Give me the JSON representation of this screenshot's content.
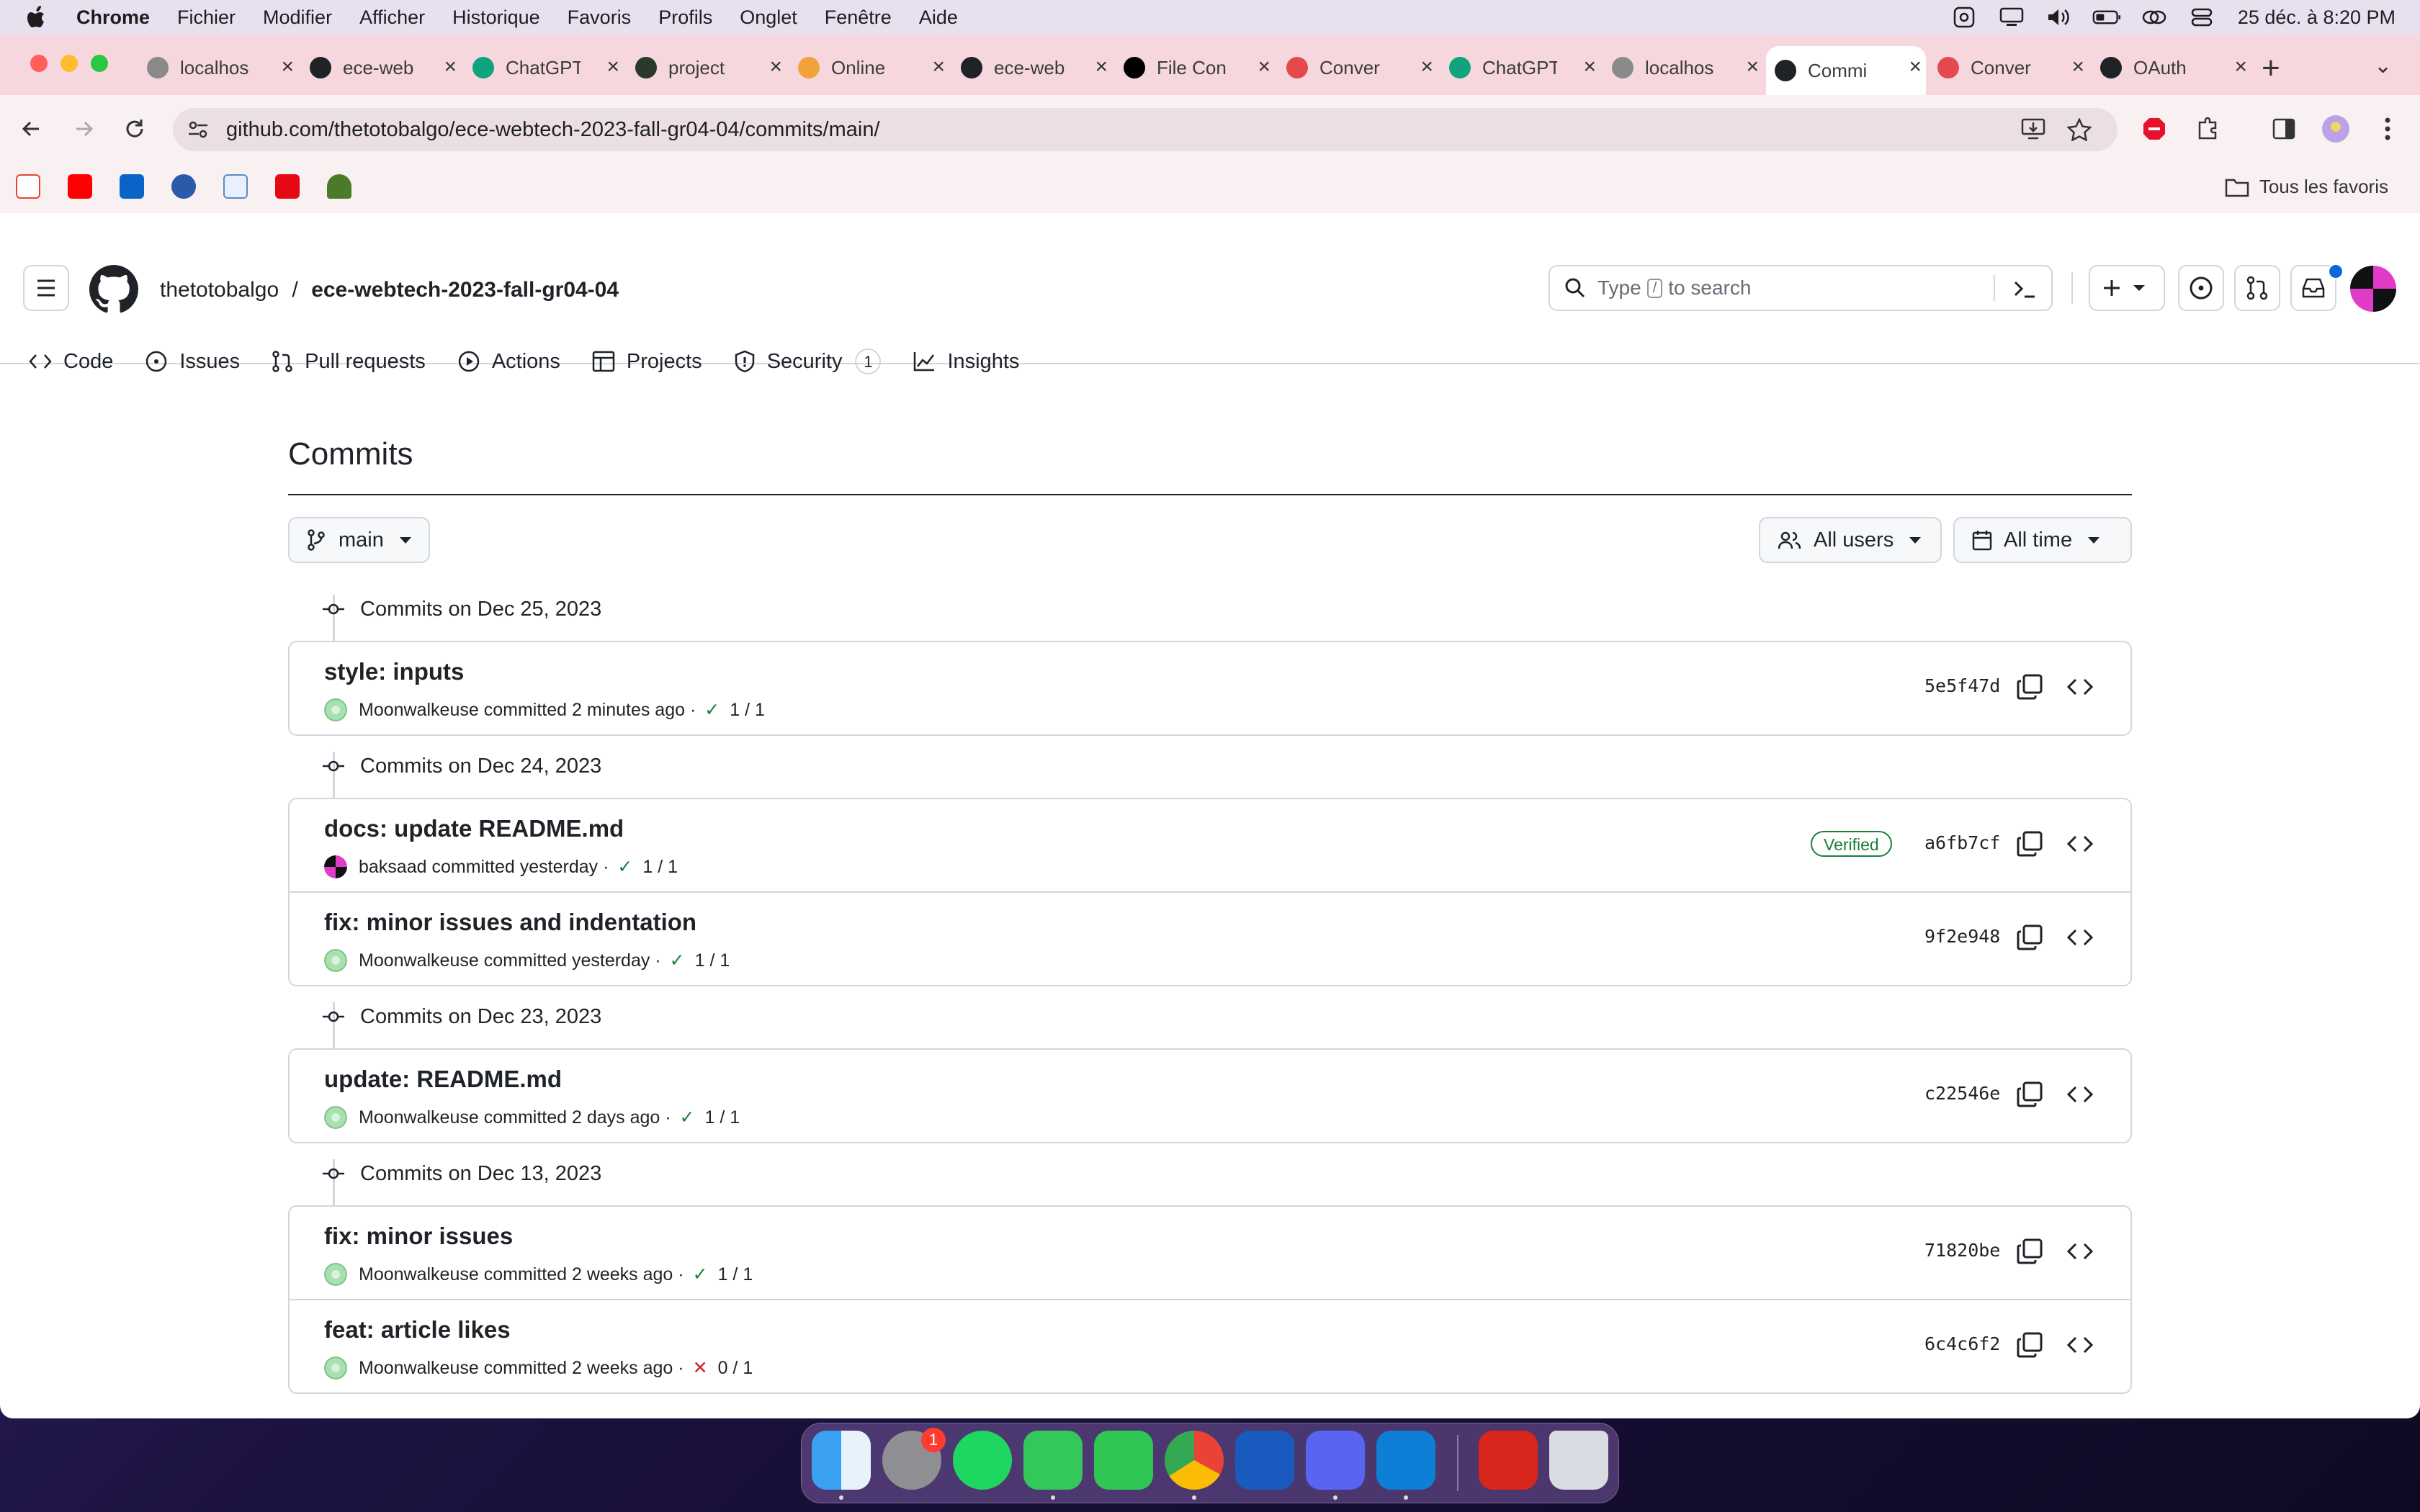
{
  "menubar": {
    "app": "Chrome",
    "items": [
      "Fichier",
      "Modifier",
      "Afficher",
      "Historique",
      "Favoris",
      "Profils",
      "Onglet",
      "Fenêtre",
      "Aide"
    ],
    "clock": "25 déc. à 8:20 PM"
  },
  "tabs": [
    {
      "title": "localhos",
      "icon": "globe-icon"
    },
    {
      "title": "ece-web",
      "icon": "github-icon"
    },
    {
      "title": "ChatGPT",
      "icon": "openai-icon"
    },
    {
      "title": "project",
      "icon": "project-icon"
    },
    {
      "title": "Online",
      "icon": "online-icon"
    },
    {
      "title": "ece-web",
      "icon": "github-icon"
    },
    {
      "title": "File Con",
      "icon": "nextjs-icon"
    },
    {
      "title": "Conver",
      "icon": "convert-icon"
    },
    {
      "title": "ChatGPT",
      "icon": "openai-icon"
    },
    {
      "title": "localhos",
      "icon": "globe-icon"
    },
    {
      "title": "Commi",
      "icon": "github-icon",
      "active": true
    },
    {
      "title": "Conver",
      "icon": "convert-icon"
    },
    {
      "title": "OAuth",
      "icon": "github-icon"
    }
  ],
  "browser": {
    "url": "github.com/thetotobalgo/ece-webtech-2023-fall-gr04-04/commits/main/",
    "all_bookmarks": "Tous les favoris"
  },
  "github": {
    "owner": "thetotobalgo",
    "separator": "/",
    "repo": "ece-webtech-2023-fall-gr04-04",
    "search_prefix": "Type",
    "search_key": "/",
    "search_suffix": "to search",
    "nav": {
      "code": "Code",
      "issues": "Issues",
      "pulls": "Pull requests",
      "actions": "Actions",
      "projects": "Projects",
      "security": "Security",
      "security_count": "1",
      "insights": "Insights"
    },
    "page_title": "Commits",
    "branch": "main",
    "users_filter": "All users",
    "time_filter": "All time",
    "verified_label": "Verified",
    "groups": [
      {
        "date": "Commits on Dec 25, 2023",
        "commits": [
          {
            "message": "style: inputs",
            "author": "Moonwalkeuse",
            "time": "committed 2 minutes ago",
            "sep": "·",
            "status": "1 / 1",
            "ok": true,
            "sha": "5e5f47d"
          }
        ]
      },
      {
        "date": "Commits on Dec 24, 2023",
        "commits": [
          {
            "message": "docs: update README.md",
            "author": "baksaad",
            "time": "committed yesterday",
            "sep": "·",
            "status": "1 / 1",
            "ok": true,
            "sha": "a6fb7cf",
            "verified": true
          },
          {
            "message": "fix: minor issues and indentation",
            "author": "Moonwalkeuse",
            "time": "committed yesterday",
            "sep": "·",
            "status": "1 / 1",
            "ok": true,
            "sha": "9f2e948"
          }
        ]
      },
      {
        "date": "Commits on Dec 23, 2023",
        "commits": [
          {
            "message": "update: README.md",
            "author": "Moonwalkeuse",
            "time": "committed 2 days ago",
            "sep": "·",
            "status": "1 / 1",
            "ok": true,
            "sha": "c22546e"
          }
        ]
      },
      {
        "date": "Commits on Dec 13, 2023",
        "commits": [
          {
            "message": "fix: minor issues",
            "author": "Moonwalkeuse",
            "time": "committed 2 weeks ago",
            "sep": "·",
            "status": "1 / 1",
            "ok": true,
            "sha": "71820be"
          },
          {
            "message": "feat: article likes",
            "author": "Moonwalkeuse",
            "time": "committed 2 weeks ago",
            "sep": "·",
            "status": "0 / 1",
            "ok": false,
            "sha": "6c4c6f2"
          }
        ]
      }
    ]
  },
  "dock": {
    "apps": [
      "finder",
      "system-settings",
      "spotify",
      "messages",
      "facetime",
      "chrome",
      "word",
      "discord",
      "vscode",
      "acrobat",
      "trash"
    ],
    "settings_badge": "1"
  },
  "colors": {
    "accent_green": "#1a7f37",
    "danger_red": "#cf222e",
    "tabbar": "#f6d7dd"
  }
}
